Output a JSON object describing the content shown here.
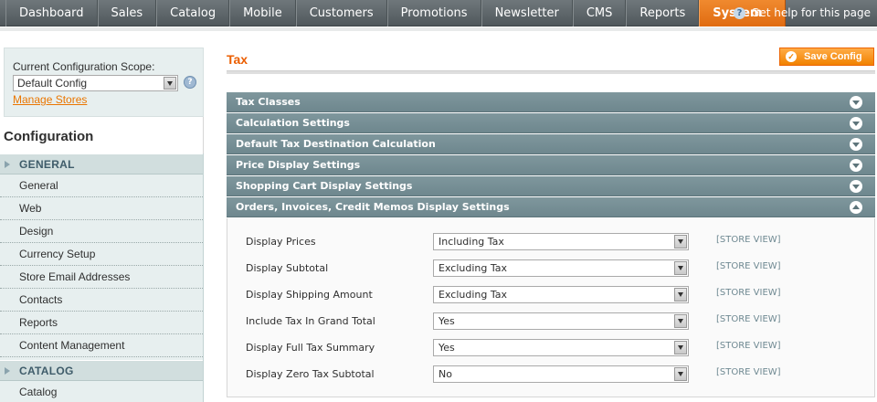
{
  "nav": {
    "items": [
      "Dashboard",
      "Sales",
      "Catalog",
      "Mobile",
      "Customers",
      "Promotions",
      "Newsletter",
      "CMS",
      "Reports",
      "System"
    ],
    "active": "System",
    "help_text": "Get help for this page"
  },
  "scope": {
    "label": "Current Configuration Scope:",
    "selected": "Default Config",
    "manage_link": "Manage Stores"
  },
  "sidebar": {
    "title": "Configuration",
    "groups": [
      {
        "label": "GENERAL",
        "items": [
          "General",
          "Web",
          "Design",
          "Currency Setup",
          "Store Email Addresses",
          "Contacts",
          "Reports",
          "Content Management"
        ]
      },
      {
        "label": "CATALOG",
        "items": [
          "Catalog"
        ]
      }
    ]
  },
  "main": {
    "title": "Tax",
    "save_label": "Save Config",
    "sections": [
      {
        "label": "Tax Classes",
        "expanded": false
      },
      {
        "label": "Calculation Settings",
        "expanded": false
      },
      {
        "label": "Default Tax Destination Calculation",
        "expanded": false
      },
      {
        "label": "Price Display Settings",
        "expanded": false
      },
      {
        "label": "Shopping Cart Display Settings",
        "expanded": false
      },
      {
        "label": "Orders, Invoices, Credit Memos Display Settings",
        "expanded": true
      }
    ],
    "fields": [
      {
        "label": "Display Prices",
        "value": "Including Tax",
        "scope": "[STORE VIEW]"
      },
      {
        "label": "Display Subtotal",
        "value": "Excluding Tax",
        "scope": "[STORE VIEW]"
      },
      {
        "label": "Display Shipping Amount",
        "value": "Excluding Tax",
        "scope": "[STORE VIEW]"
      },
      {
        "label": "Include Tax In Grand Total",
        "value": "Yes",
        "scope": "[STORE VIEW]"
      },
      {
        "label": "Display Full Tax Summary",
        "value": "Yes",
        "scope": "[STORE VIEW]"
      },
      {
        "label": "Display Zero Tax Subtotal",
        "value": "No",
        "scope": "[STORE VIEW]"
      }
    ]
  },
  "colors": {
    "accent": "#eb5e00",
    "section_header": "#778f95",
    "sidebar_bg": "#e7efef"
  }
}
